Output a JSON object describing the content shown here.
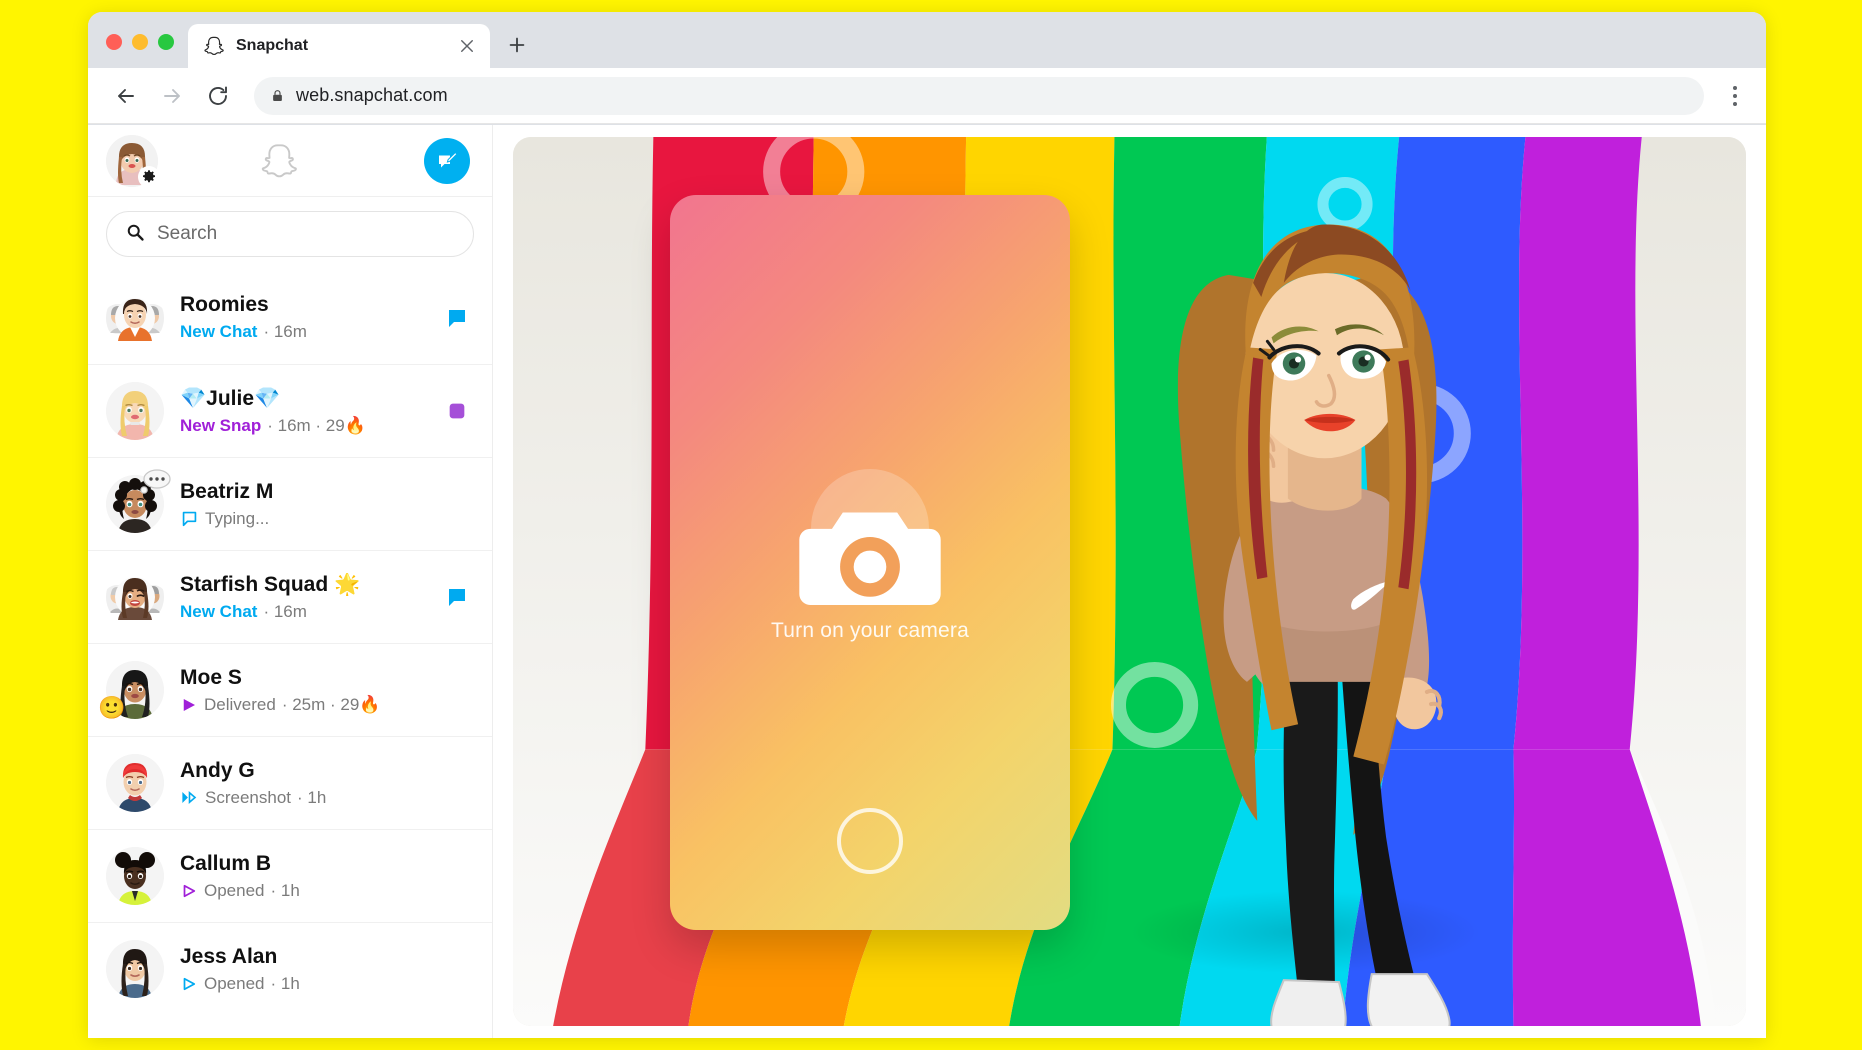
{
  "browser": {
    "tab": {
      "title": "Snapchat",
      "favicon_icon": "snapchat-ghost-icon",
      "close_icon": "close-icon"
    },
    "new_tab_icon": "plus-icon",
    "back_icon": "arrow-left-icon",
    "forward_icon": "arrow-right-icon",
    "reload_icon": "reload-icon",
    "lock_icon": "lock-icon",
    "url": "web.snapchat.com",
    "menu_icon": "kebab-menu-icon",
    "window_controls": {
      "close": "close-window-dot",
      "minimize": "minimize-window-dot",
      "maximize": "maximize-window-dot"
    }
  },
  "sidebar": {
    "profile_avatar_name": "my-bitmoji-avatar",
    "settings_icon": "gear-icon",
    "logo_icon": "snapchat-ghost-outline-icon",
    "new_chat_icon": "new-chat-pencil-icon",
    "search": {
      "placeholder": "Search",
      "icon": "search-icon",
      "value": ""
    },
    "chats": [
      {
        "name": "Roomies",
        "status": "New Chat",
        "status_color": "blue",
        "meta": " · 16m",
        "avatar": "group-avatar-roomies",
        "right_icon": "chat-bubble-filled-blue-icon",
        "left_status_icon": ""
      },
      {
        "name": "💎Julie💎",
        "status": "New Snap",
        "status_color": "purple",
        "meta": " · 16m · 29🔥",
        "avatar": "bitmoji-julie",
        "right_icon": "snap-square-filled-purple-icon",
        "left_status_icon": ""
      },
      {
        "name": "Beatriz M",
        "status": "Typing...",
        "status_color": "gray",
        "meta": "",
        "avatar": "bitmoji-beatriz",
        "right_icon": "",
        "left_status_icon": "chat-bubble-outline-blue-icon",
        "avatar_badge": "typing-bubble-badge"
      },
      {
        "name": "Starfish Squad 🌟",
        "status": "New Chat",
        "status_color": "blue",
        "meta": " · 16m",
        "avatar": "group-avatar-starfish-squad",
        "right_icon": "chat-bubble-filled-blue-icon",
        "left_status_icon": ""
      },
      {
        "name": "Moe S",
        "status": "Delivered",
        "status_color": "gray",
        "meta": " · 25m · 29🔥",
        "avatar": "bitmoji-moe",
        "right_icon": "",
        "left_status_icon": "snap-arrow-filled-purple-icon",
        "avatar_emoji": "🙂"
      },
      {
        "name": "Andy G",
        "status": "Screenshot",
        "status_color": "gray",
        "meta": " · 1h",
        "avatar": "bitmoji-andy",
        "right_icon": "",
        "left_status_icon": "screenshot-arrows-blue-icon"
      },
      {
        "name": "Callum B",
        "status": "Opened",
        "status_color": "gray",
        "meta": " · 1h",
        "avatar": "bitmoji-callum",
        "right_icon": "",
        "left_status_icon": "snap-arrow-outline-purple-icon"
      },
      {
        "name": "Jess Alan",
        "status": "Opened",
        "status_color": "gray",
        "meta": " · 1h",
        "avatar": "bitmoji-jess",
        "right_icon": "",
        "left_status_icon": "chat-arrow-outline-blue-icon"
      }
    ]
  },
  "main": {
    "camera_label": "Turn on your camera",
    "camera_icon": "camera-icon",
    "shutter_icon": "shutter-ring-button",
    "backdrop_name": "rainbow-bitmoji-backdrop",
    "bitmoji_name": "bitmoji-peace-sign-character"
  },
  "colors": {
    "page_background": "#FFF500",
    "accent_blue": "#00AAF0",
    "accent_purple": "#A020D8",
    "rainbow": [
      "#E8163F",
      "#FF9500",
      "#FFD500",
      "#00C853",
      "#00D9F0",
      "#2E5BFF",
      "#C020DC"
    ],
    "stage_background": "#E8E6DE"
  }
}
